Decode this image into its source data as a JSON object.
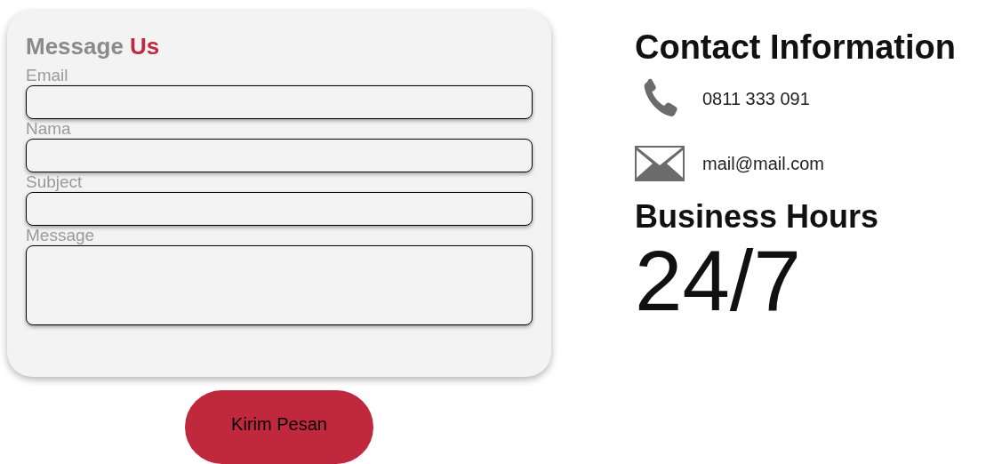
{
  "form": {
    "title": "Message",
    "title_accent": "Us",
    "fields": [
      {
        "label": "Email",
        "kind": "input"
      },
      {
        "label": "Nama",
        "kind": "input"
      },
      {
        "label": "Subject",
        "kind": "input"
      },
      {
        "label": "Message",
        "kind": "textarea"
      }
    ],
    "submit": "Kirim Pesan"
  },
  "contact": {
    "title": "Contact Information",
    "items": [
      {
        "kind": "phone",
        "text": "0811 333 091"
      },
      {
        "kind": "mail",
        "text": "mail@mail.com"
      }
    ],
    "hours_title": "Business Hours",
    "hours": "24/7"
  }
}
